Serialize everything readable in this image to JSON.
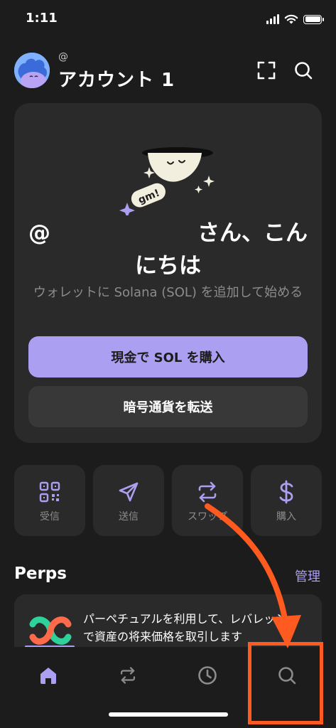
{
  "status_bar": {
    "time": "1:11"
  },
  "header": {
    "handle": "@",
    "account_name": "アカウント 1",
    "icons": [
      "avatar",
      "scan-icon",
      "search-icon"
    ]
  },
  "welcome": {
    "badge_text": "gm!",
    "greeting_prefix": "@",
    "greeting_suffix": "さん、こん",
    "greeting_line2": "にちは",
    "subtitle": "ウォレットに Solana (SOL) を追加して始める",
    "buy_button": "現金で SOL を購入",
    "transfer_button": "暗号通貨を転送"
  },
  "actions": [
    {
      "label": "受信",
      "icon": "qr-code-icon"
    },
    {
      "label": "送信",
      "icon": "send-icon"
    },
    {
      "label": "スワップ",
      "icon": "swap-icon"
    },
    {
      "label": "購入",
      "icon": "dollar-icon"
    }
  ],
  "perps": {
    "title": "Perps",
    "manage": "管理",
    "description": "パーペチュアルを利用して、レバレッジで資産の将来価格を取引します"
  },
  "tabbar": {
    "tabs": [
      "home-icon",
      "swap-icon",
      "history-icon",
      "search-icon"
    ],
    "active": "home-icon"
  },
  "colors": {
    "background": "#1c1c1c",
    "card": "#2a2a2a",
    "accent": "#ab9ff2",
    "highlight": "#ff5a1f"
  }
}
